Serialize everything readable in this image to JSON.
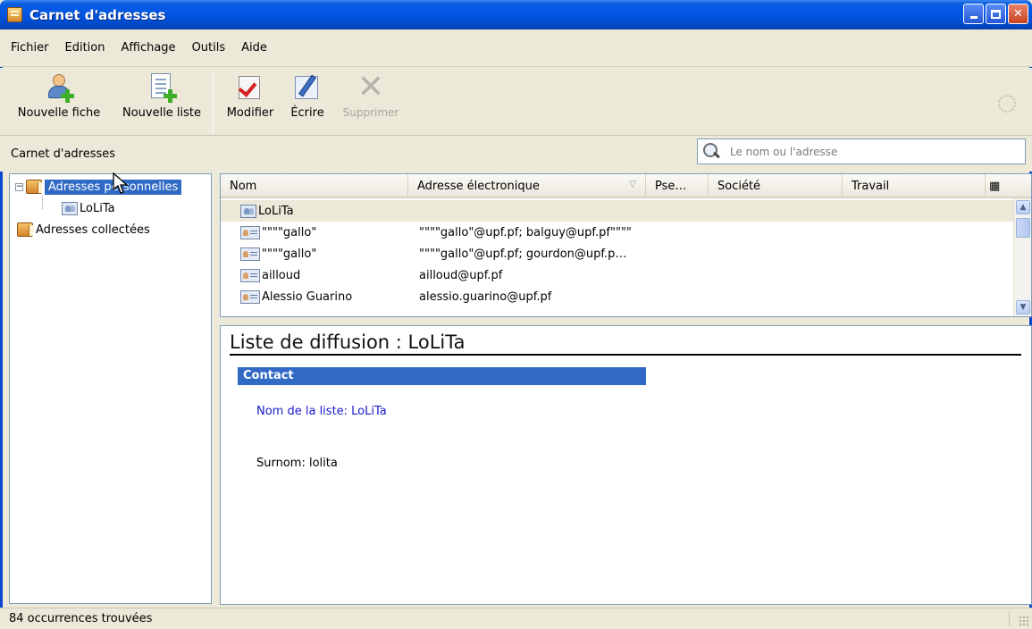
{
  "window": {
    "title": "Carnet d'adresses"
  },
  "menu": [
    {
      "label": "Fichier"
    },
    {
      "label": "Edition"
    },
    {
      "label": "Affichage"
    },
    {
      "label": "Outils"
    },
    {
      "label": "Aide"
    }
  ],
  "toolbar": {
    "new_card": "Nouvelle fiche",
    "new_list": "Nouvelle liste",
    "edit": "Modifier",
    "write": "Écrire",
    "delete": "Supprimer"
  },
  "subheader": {
    "caption": "Carnet d'adresses",
    "search_placeholder": "Le nom ou l'adresse"
  },
  "tree": {
    "personal": "Adresses personnelles",
    "lolita": "LoLiTa",
    "collected": "Adresses collectées"
  },
  "table": {
    "columns": [
      "Nom",
      "Adresse électronique",
      "Pse…",
      "Société",
      "Travail"
    ],
    "rows": [
      {
        "name": "LoLiTa",
        "email": ""
      },
      {
        "name": "\"\"\"\"gallo\"",
        "email": "\"\"\"\"gallo\"@upf.pf; balguy@upf.pf\"\"\"\""
      },
      {
        "name": "\"\"\"\"gallo\"",
        "email": "\"\"\"\"gallo\"@upf.pf; gourdon@upf.p…"
      },
      {
        "name": "ailloud",
        "email": "ailloud@upf.pf"
      },
      {
        "name": "Alessio Guarino",
        "email": "alessio.guarino@upf.pf"
      }
    ]
  },
  "details": {
    "title": "Liste de diffusion : LoLiTa",
    "section": "Contact",
    "list_name": "Nom de la liste: LoLiTa",
    "nickname": "Surnom: lolita"
  },
  "status": {
    "text": "84 occurrences trouvées"
  },
  "colors": {
    "selection": "#316ac5",
    "titlebar": "#0054e3",
    "chrome": "#ece9d8",
    "link_blue": "#1a1acc"
  }
}
